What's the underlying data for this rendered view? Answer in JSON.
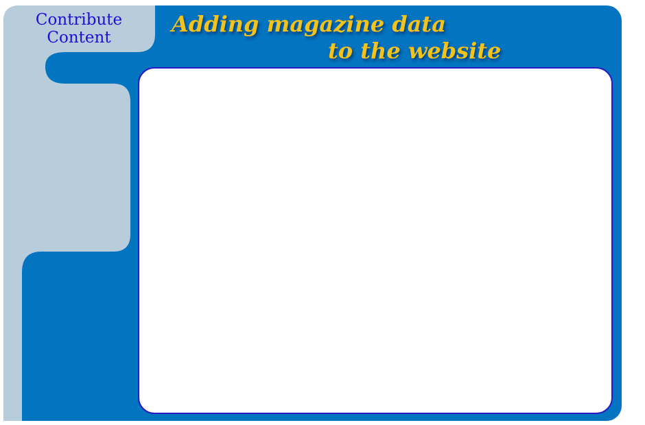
{
  "window": {
    "section_title_line_1": "Contribute",
    "section_title_line_2": "Content",
    "heading_line_1": "Adding magazine data",
    "heading_line_2": "to the website"
  },
  "colors": {
    "frame_blue": "#0374c0",
    "sidebar_grey": "#b7cddb",
    "section_title": "#1a10d8",
    "heading_gold": "#f3c21b",
    "panel_border": "#2a18c2",
    "panel_fill": "#ffffff"
  }
}
